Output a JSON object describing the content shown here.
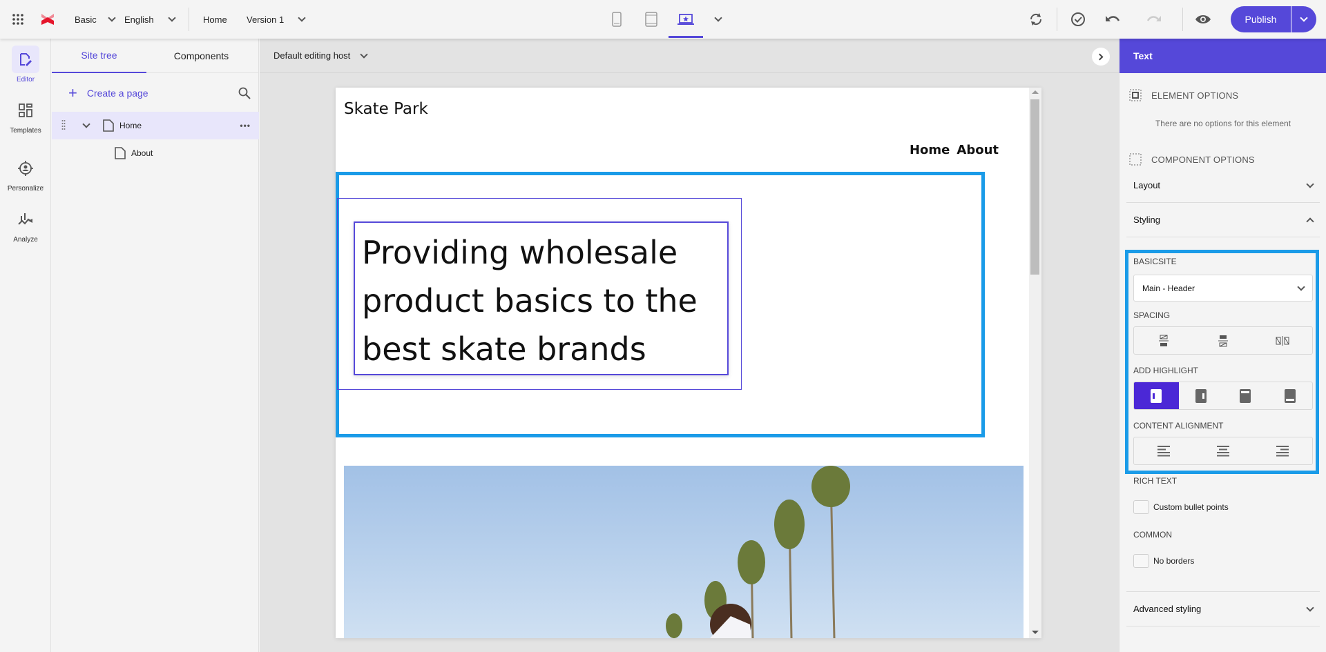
{
  "topbar": {
    "apps_icon": "grid-dots-icon",
    "logo": "sitecore-logo",
    "site": "Basic",
    "language": "English",
    "page": "Home",
    "version": "Version 1",
    "devices": [
      "mobile",
      "tablet",
      "desktop"
    ],
    "active_device": "desktop",
    "publish_label": "Publish"
  },
  "leftnav": {
    "items": [
      {
        "label": "Editor",
        "icon": "editor-icon",
        "active": true
      },
      {
        "label": "Templates",
        "icon": "templates-icon",
        "active": false
      },
      {
        "label": "Personalize",
        "icon": "personalize-icon",
        "active": false
      },
      {
        "label": "Analyze",
        "icon": "analyze-icon",
        "active": false
      }
    ]
  },
  "sitetree": {
    "tabs": [
      {
        "label": "Site tree",
        "active": true
      },
      {
        "label": "Components",
        "active": false
      }
    ],
    "create_label": "Create a page",
    "items": [
      {
        "label": "Home",
        "selected": true,
        "expanded": true
      },
      {
        "label": "About",
        "selected": false
      }
    ]
  },
  "canvas": {
    "host_label": "Default editing host",
    "page": {
      "site_title": "Skate Park",
      "nav": [
        "Home",
        "About"
      ],
      "headline": "Providing wholesale product basics to the best skate brands",
      "image_alt": "skater under palm trees"
    }
  },
  "rpanel": {
    "title": "Text",
    "element_options_label": "ELEMENT OPTIONS",
    "no_options": "There are no options for this element",
    "component_options_label": "COMPONENT OPTIONS",
    "layout_label": "Layout",
    "styling_label": "Styling",
    "basicsite_label": "BASICSITE",
    "basicsite_value": "Main - Header",
    "spacing_label": "SPACING",
    "highlight_label": "ADD HIGHLIGHT",
    "highlight_selected": 0,
    "alignment_label": "CONTENT ALIGNMENT",
    "richtext_label": "RICH TEXT",
    "custom_bullets_label": "Custom bullet points",
    "custom_bullets_checked": false,
    "common_label": "COMMON",
    "no_borders_label": "No borders",
    "no_borders_checked": false,
    "advanced_label": "Advanced styling"
  }
}
